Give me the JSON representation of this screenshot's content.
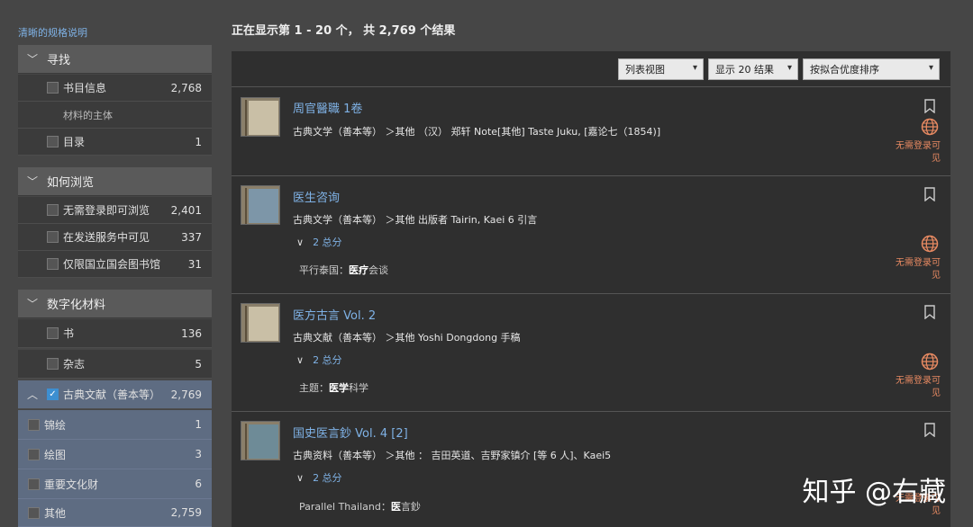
{
  "sidebar": {
    "clear_link": "清晰的规格说明",
    "sections": [
      {
        "title": "寻找"
      },
      {
        "title": "如何浏览"
      },
      {
        "title": "数字化材料"
      }
    ],
    "find_items": [
      {
        "label": "书目信息",
        "count": "2,768"
      },
      {
        "label": "材料的主体"
      },
      {
        "label": "目录",
        "count": "1"
      }
    ],
    "browse_items": [
      {
        "label": "无需登录即可浏览",
        "count": "2,401"
      },
      {
        "label": "在发送服务中可见",
        "count": "337"
      },
      {
        "label": "仅限国立国会图书馆",
        "count": "31"
      }
    ],
    "digital_items": [
      {
        "label": "书",
        "count": "136"
      },
      {
        "label": "杂志",
        "count": "5"
      },
      {
        "label": "古典文献（善本等）",
        "count": "2,769"
      },
      {
        "label": "锦绘",
        "count": "1"
      },
      {
        "label": "绘图",
        "count": "3"
      },
      {
        "label": "重要文化财",
        "count": "6"
      },
      {
        "label": "其他",
        "count": "2,759"
      }
    ]
  },
  "main": {
    "results_count": "正在显示第 1 - 20 个，  共 2,769 个结果",
    "view_select": "列表视图",
    "per_page_select": "显示 20 结果",
    "sort_select": "按拟合优度排序"
  },
  "results": [
    {
      "title": "周官醫職 1卷",
      "meta": "古典文学（善本等） ＞其他 （汉） 郑轩 Note[其他] Taste Juku,  [嘉论七（1854)]",
      "availability": "无需登录可见"
    },
    {
      "title": "医生咨询",
      "meta": "古典文学（善本等） ＞其他 出版者 Tairin,   Kaei 6 引言",
      "more": "2 总分",
      "extra_label": "平行泰国：",
      "extra_bold": "医疗",
      "extra_rest": "会谈",
      "availability": "无需登录可见"
    },
    {
      "title": "医方古言 Vol. 2",
      "meta": "古典文献（善本等） ＞其他 Yoshi Dongdong 手稿",
      "more": "2 总分",
      "extra_label": "主题：",
      "extra_bold": "医学",
      "extra_rest": "科学",
      "availability": "无需登录可见"
    },
    {
      "title": "国史医言鈔 Vol. 4 [2]",
      "meta": "古典资料（善本等） ＞其他 ： 吉田英道、吉野家镇介 [等 6 人]、Kaei5",
      "more": "2 总分",
      "extra_label": "Parallel Thailand：",
      "extra_bold": "医",
      "extra_rest": "言鈔",
      "availability": "无需登录可见"
    }
  ],
  "watermark": "知乎 @右藏"
}
